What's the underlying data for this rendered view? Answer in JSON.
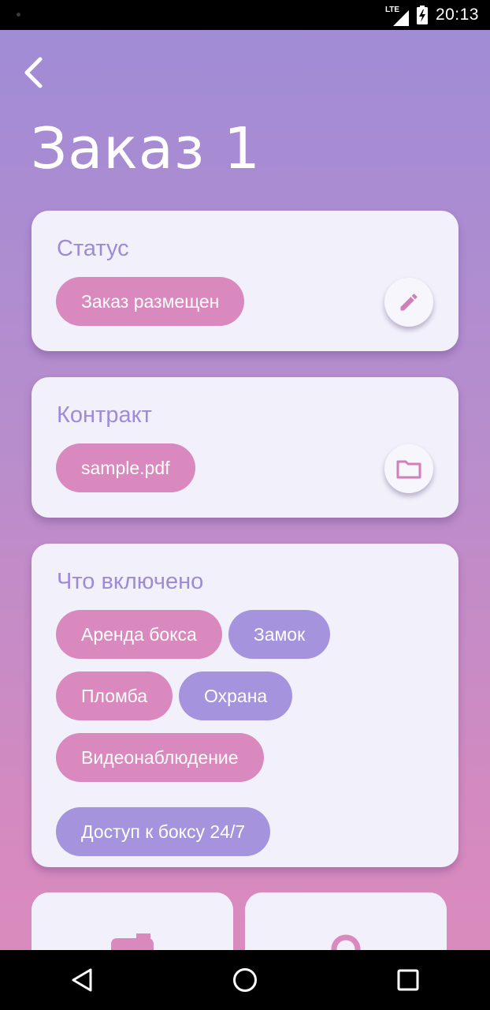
{
  "status_bar": {
    "network": "LTE",
    "time": "20:13"
  },
  "header": {
    "title": "Заказ 1"
  },
  "status_card": {
    "title": "Статус",
    "chip": "Заказ размещен",
    "action_icon": "pencil-icon"
  },
  "contract_card": {
    "title": "Контракт",
    "chip": "sample.pdf",
    "action_icon": "folder-icon"
  },
  "included_card": {
    "title": "Что включено",
    "chips": [
      {
        "label": "Аренда бокса",
        "color": "pink"
      },
      {
        "label": "Замок",
        "color": "violet"
      },
      {
        "label": "Пломба",
        "color": "pink"
      },
      {
        "label": "Охрана",
        "color": "violet"
      },
      {
        "label": "Видеонаблюдение",
        "color": "pink"
      },
      {
        "label": "Доступ к боксу 24/7",
        "color": "violet"
      }
    ]
  },
  "colors": {
    "chip_pink": "#d989be",
    "chip_violet": "#a593dd",
    "card_title": "#9e8bd6",
    "card_bg": "#f2f1fb"
  },
  "nav_bar": {
    "icons": [
      "back-triangle-icon",
      "home-circle-icon",
      "recents-square-icon"
    ]
  }
}
